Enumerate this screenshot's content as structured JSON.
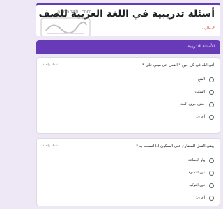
{
  "header": {
    "title": "أسئلة تدريبية في اللغة العربية للصف الثامن",
    "required_note": "*مطلوب",
    "watermark_url": "almanahj.com",
    "watermark_text": "موقع المناهج السعودية"
  },
  "section": {
    "title": "الأسئلة التدريبية"
  },
  "questions": [
    {
      "title": "أتى الله في كل حين * الفعل أتى مبني على *",
      "points": "نقطة واحدة",
      "options": [
        "الفتح",
        "السكون",
        "حذف حرف العلة",
        "أخرى:"
      ]
    },
    {
      "title": "يبقى الفعل المضارع على السكون اذا اتصلت به *",
      "points": "نقطة واحدة",
      "options": [
        "واو الجماعة",
        "نون النسوة",
        "نون التوكيد",
        "أخرى:"
      ]
    }
  ],
  "colors": {
    "accent": "#673ab7",
    "background": "#ede7f6",
    "required": "#d93025"
  }
}
